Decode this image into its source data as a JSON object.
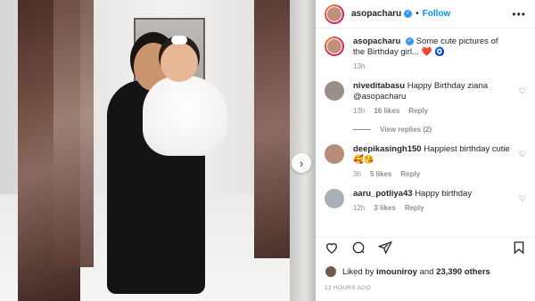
{
  "header": {
    "username": "asopacharu",
    "separator": "•",
    "follow_label": "Follow",
    "more_label": "•••"
  },
  "caption": {
    "username": "asopacharu",
    "text": "Some cute pictures of the Birthday girl...",
    "emojis": "❤️ 🧿",
    "time": "13h"
  },
  "comments": [
    {
      "username": "niveditabasu",
      "text": "Happy Birthday ziana @asopacharu",
      "time": "13h",
      "likes": "16 likes",
      "reply": "Reply"
    },
    {
      "username": "deepikasingh150",
      "text": "Happiest birthday cutie 🥰😘",
      "time": "3h",
      "likes": "5 likes",
      "reply": "Reply"
    },
    {
      "username": "aaru_potliya43",
      "text": "Happy birthday",
      "time": "12h",
      "likes": "3 likes",
      "reply": "Reply"
    }
  ],
  "view_replies": "View replies (2)",
  "likes": {
    "prefix": "Liked by",
    "user": "imouniroy",
    "and": "and",
    "count": "23,390 others"
  },
  "timestamp": "13 HOURS AGO",
  "photo": {
    "next_arrow": "›"
  },
  "icons": [
    "heart-icon",
    "comment-icon",
    "share-icon",
    "bookmark-icon",
    "more-icon",
    "verified-icon",
    "next-arrow-icon"
  ],
  "colors": {
    "accent": "#0095f6",
    "verified": "#3897f0",
    "muted": "#8e8e8e"
  }
}
